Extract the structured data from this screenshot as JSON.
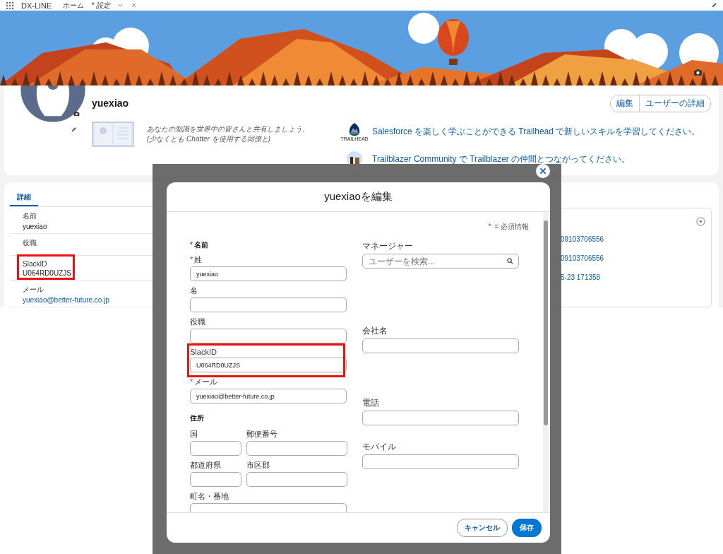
{
  "nav": {
    "app_name": "DX-LINE",
    "tabs": [
      {
        "label": "ホーム",
        "selected": false
      },
      {
        "label": "* 設定",
        "selected": true
      }
    ]
  },
  "profile": {
    "name": "yuexiao",
    "buttons": [
      "編集",
      "ユーザーの詳細"
    ],
    "chatter_prompt": [
      "あなたの知識を世界中の皆さんと共有しましょう。",
      "(少なくとも Chatter を使用する同僚と)"
    ],
    "trailhead_logo_text": "TRAILHEAD",
    "links": [
      "Salesforce を楽しく学ぶことができる Trailhead で新しいスキルを学習してください。",
      "Trailblazer Community で Trailblazer の仲間とつながってください。"
    ]
  },
  "details": {
    "tabs": [
      {
        "label": "詳細",
        "selected": true
      }
    ],
    "fields": [
      {
        "label": "名前",
        "value": "yuexiao",
        "kind": "text",
        "highlighted": false
      },
      {
        "label": "役職",
        "highlighted": false
      },
      {
        "label": "SlackID",
        "value": "U064RD0UZJS",
        "kind": "text",
        "highlighted": true
      },
      {
        "label": "メール",
        "value": "yuexiao@better-future.co.jp",
        "kind": "link",
        "highlighted": false
      }
    ]
  },
  "activity": {
    "items": [
      "09103706556",
      "09103706556",
      "5-23 171358"
    ]
  },
  "modal": {
    "title": "yuexiaoを編集",
    "required_mark": "*",
    "required_legend": "= 必須情報",
    "left": [
      {
        "kind": "section",
        "label": "名前",
        "required": true
      },
      {
        "kind": "input",
        "label": "姓",
        "required": true,
        "value": "yuexiao",
        "highlighted": false
      },
      {
        "kind": "input",
        "label": "名",
        "required": false,
        "highlighted": false
      },
      {
        "kind": "input",
        "label": "役職",
        "required": false,
        "highlighted": false
      },
      {
        "kind": "input",
        "label": "SlackID",
        "required": false,
        "value": "U064RD0UZJS",
        "highlighted": true
      },
      {
        "kind": "input",
        "label": "メール",
        "required": true,
        "value": "yuexiao@better-future.co.jp",
        "highlighted": false
      },
      {
        "kind": "address",
        "label": "住所",
        "fields": [
          "国",
          "郵便番号",
          "都道府県",
          "市区郡",
          "町名・番地"
        ]
      }
    ],
    "right": [
      {
        "kind": "search",
        "label": "マネージャー",
        "placeholder": "ユーザーを検索..."
      },
      {
        "kind": "input",
        "label": "会社名",
        "required": false,
        "highlighted": false
      },
      {
        "kind": "input",
        "label": "電話",
        "required": false,
        "highlighted": false
      },
      {
        "kind": "input",
        "label": "モバイル",
        "required": false,
        "highlighted": false
      }
    ],
    "buttons": [
      {
        "label": "キャンセル",
        "kind": "neutral"
      },
      {
        "label": "保存",
        "kind": "brand"
      }
    ]
  }
}
